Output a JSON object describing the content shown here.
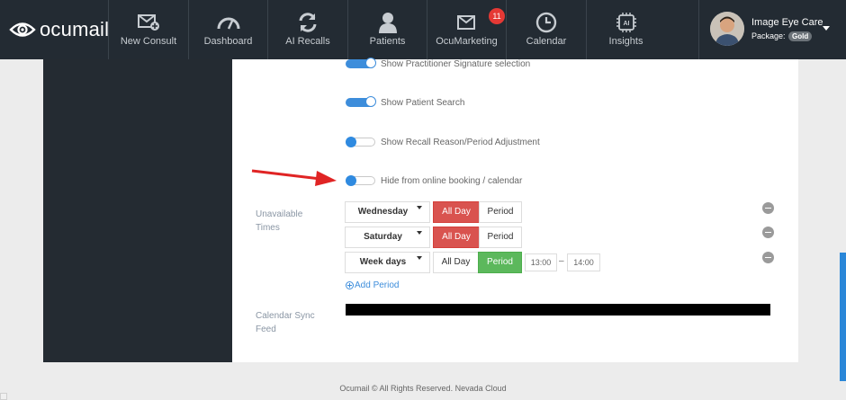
{
  "brand": {
    "name": "ocumail",
    "logo_icon": "eye-icon"
  },
  "nav": [
    {
      "label": "New Consult",
      "icon": "envelope-plus-icon"
    },
    {
      "label": "Dashboard",
      "icon": "gauge-icon"
    },
    {
      "label": "AI Recalls",
      "icon": "refresh-icon"
    },
    {
      "label": "Patients",
      "icon": "person-icon"
    },
    {
      "label": "OcuMarketing",
      "icon": "envelope-check-icon",
      "badge": "11"
    },
    {
      "label": "Calendar",
      "icon": "clock-icon"
    },
    {
      "label": "Insights",
      "icon": "ai-chip-icon"
    }
  ],
  "user": {
    "name": "Image Eye Care",
    "package_label": "Package:",
    "package_value": "Gold"
  },
  "toggles": [
    {
      "label": "Show Practitioner Signature selection",
      "on": true
    },
    {
      "label": "Show Patient Search",
      "on": true
    },
    {
      "label": "Show Recall Reason/Period Adjustment",
      "on": false
    },
    {
      "label": "Hide from online booking / calendar",
      "on": false
    }
  ],
  "unavailable": {
    "label": "Unavailable Times",
    "rows": [
      {
        "day": "Wednesday",
        "all_day": "All Day",
        "period": "Period",
        "mode": "all_day"
      },
      {
        "day": "Saturday",
        "all_day": "All Day",
        "period": "Period",
        "mode": "all_day"
      },
      {
        "day": "Week days",
        "all_day": "All Day",
        "period": "Period",
        "mode": "period",
        "start": "13:00",
        "separator": "–",
        "end": "14:00"
      }
    ],
    "add_label": "Add Period"
  },
  "calendar_sync": {
    "label": "Calendar Sync Feed"
  },
  "footer": {
    "text": "Ocumail © All Rights Reserved. Nevada Cloud"
  },
  "colors": {
    "nav_bg": "#232b33",
    "accent": "#3d8ddb",
    "danger": "#d9534f",
    "success": "#5cb85c",
    "annotation_arrow": "#e02424"
  }
}
